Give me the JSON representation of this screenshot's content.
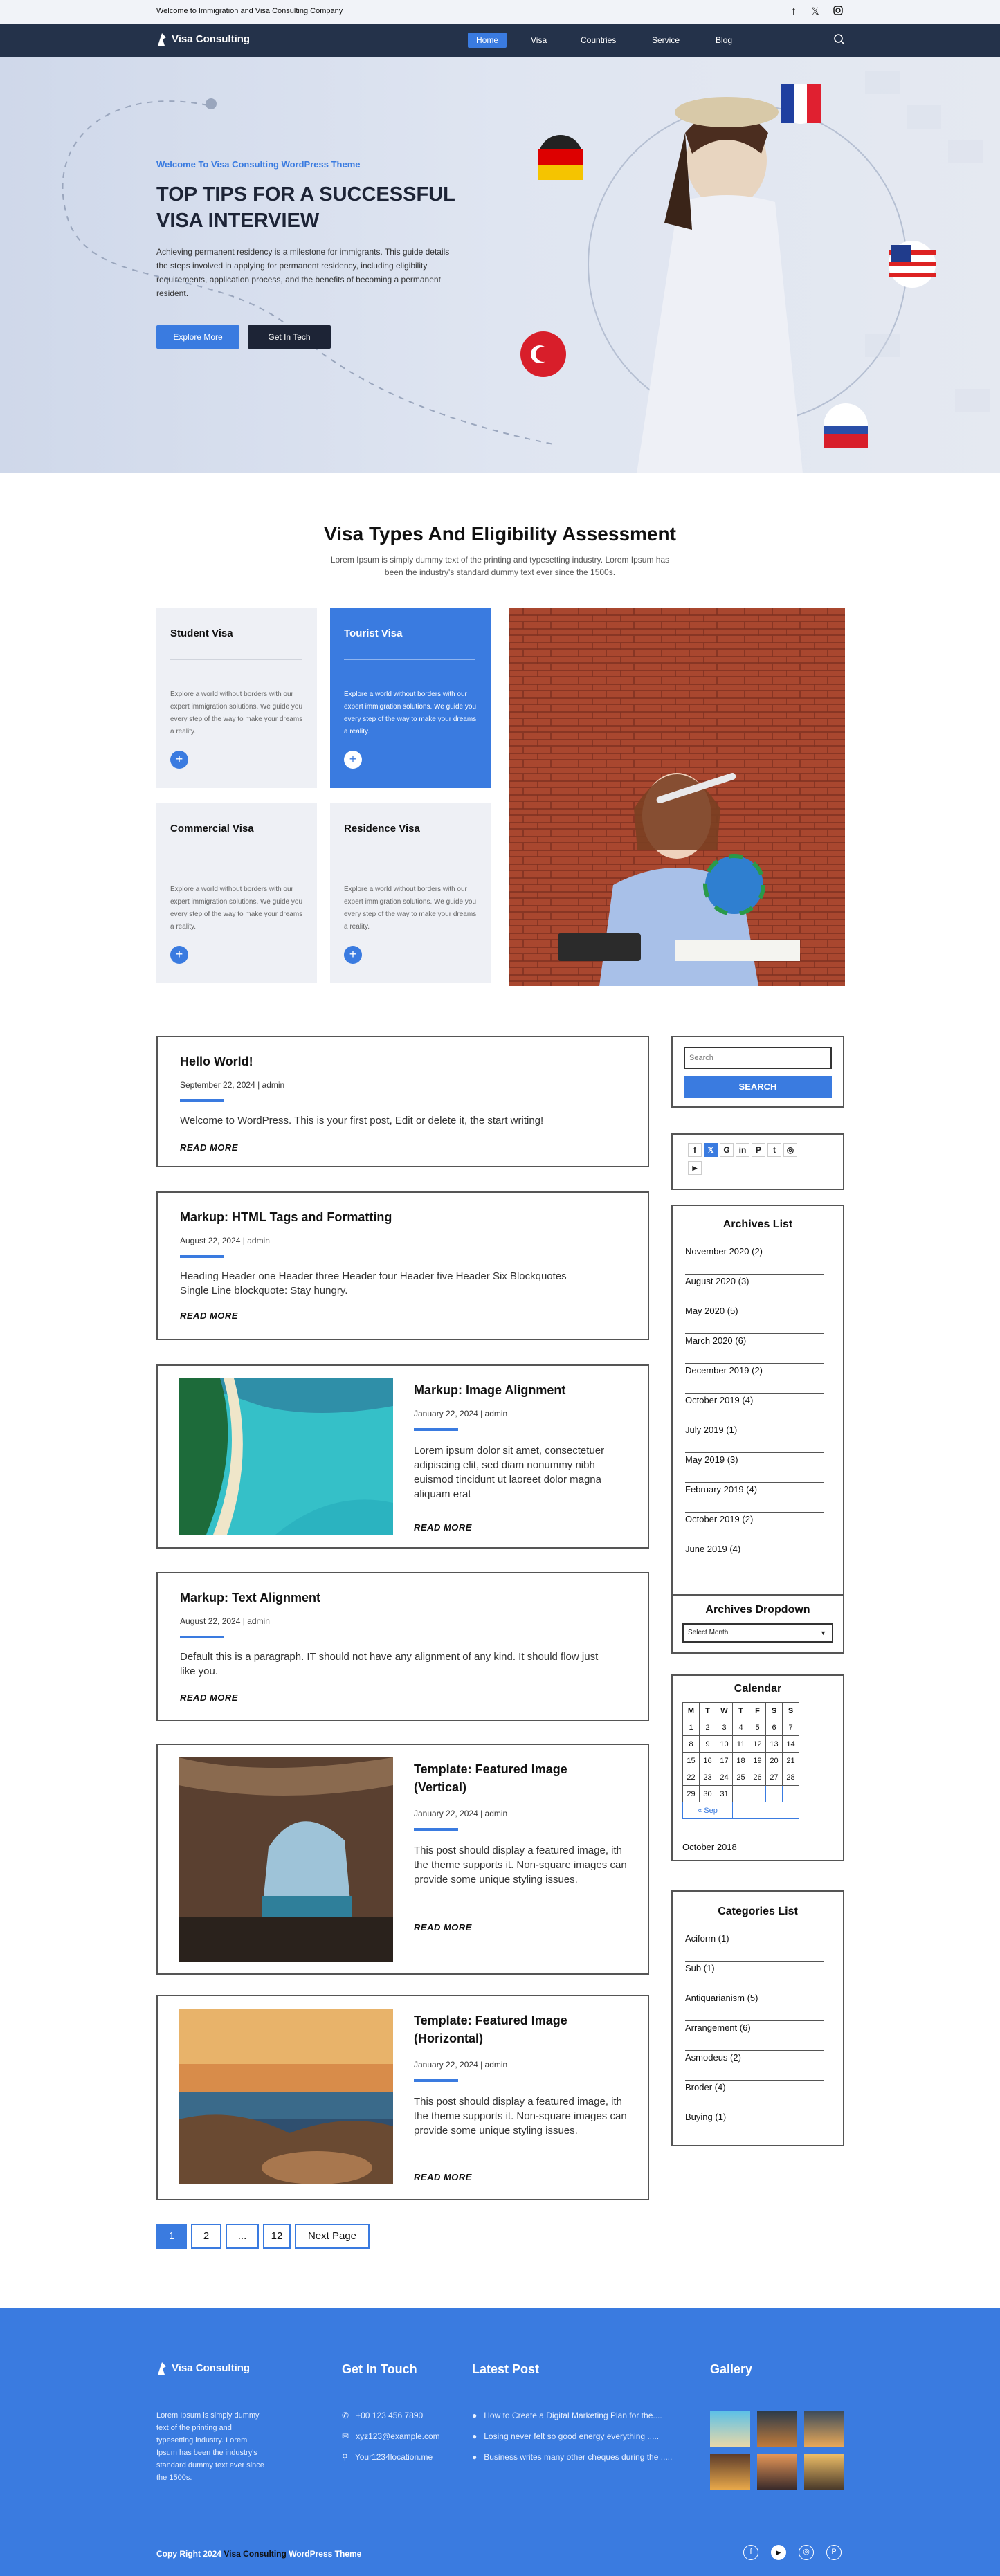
{
  "topbar": {
    "welcome": "Welcome to Immigration and Visa Consulting Company"
  },
  "brand": {
    "name": "Visa Consulting",
    "accent": "#3a7be0",
    "dark": "#24324a"
  },
  "nav": {
    "items": [
      "Home",
      "Visa",
      "Countries",
      "Service",
      "Blog"
    ],
    "active": "Home"
  },
  "hero": {
    "tagline": "Welcome To Visa Consulting WordPress Theme",
    "title": "TOP TIPS FOR A SUCCESSFUL VISA INTERVIEW",
    "desc": "Achieving permanent residency is a milestone for immigrants. This guide details the steps involved in applying for permanent residency, including eligibility requirements, application process, and the benefits of becoming a permanent resident.",
    "btn_primary": "Explore More",
    "btn_secondary": "Get In Tech"
  },
  "visa": {
    "title": "Visa Types And Eligibility Assessment",
    "subtitle": "Lorem Ipsum is simply dummy text of the printing and typesetting industry. Lorem Ipsum has been the industry's standard dummy text ever since the 1500s.",
    "cards": [
      {
        "title": "Student Visa",
        "desc": "Explore a world without borders with our expert immigration solutions. We guide you every step of the way to make your dreams a reality."
      },
      {
        "title": "Tourist Visa",
        "desc": "Explore a world without borders with our expert immigration solutions. We guide you every step of the way to make your dreams a reality."
      },
      {
        "title": "Commercial Visa",
        "desc": "Explore a world without borders with our expert immigration solutions. We guide you every step of the way to make your dreams a reality."
      },
      {
        "title": "Residence Visa",
        "desc": "Explore a world without borders with our expert immigration solutions. We guide you every step of the way to make your dreams a reality."
      }
    ]
  },
  "posts": [
    {
      "title": "Hello World!",
      "meta": "September 22, 2024 | admin",
      "excerpt": "Welcome to WordPress. This is your first post, Edit or delete it, the start writing!",
      "more": "READ MORE"
    },
    {
      "title": "Markup: HTML Tags and Formatting",
      "meta": "August 22, 2024 | admin",
      "excerpt": "Heading Header one Header three Header four Header five Header Six Blockquotes Single Line blockquote: Stay hungry.",
      "more": "READ MORE"
    },
    {
      "title": "Markup: Image Alignment",
      "meta": "January 22, 2024 | admin",
      "excerpt": "Lorem ipsum dolor sit amet, consectetuer adipiscing elit, sed diam nonummy nibh euismod tincidunt ut laoreet dolor magna aliquam erat",
      "more": "READ MORE"
    },
    {
      "title": "Markup: Text Alignment",
      "meta": "August 22, 2024 | admin",
      "excerpt": "Default this is a paragraph. IT should not have any alignment of any kind. It should flow just like you.",
      "more": "READ MORE"
    },
    {
      "title": "Template: Featured Image (Vertical)",
      "meta": "January 22, 2024 | admin",
      "excerpt": "This post should display a featured image, ith the theme supports it. Non-square images can provide some unique styling issues.",
      "more": "READ MORE"
    },
    {
      "title": "Template: Featured Image (Horizontal)",
      "meta": "January 22, 2024 | admin",
      "excerpt": "This post should display a featured image, ith the theme supports it. Non-square images can provide some unique styling issues.",
      "more": "READ MORE"
    }
  ],
  "pagination": {
    "items": [
      "1",
      "2",
      "...",
      "12"
    ],
    "next": "Next Page"
  },
  "sidebar": {
    "search": {
      "placeholder": "Search",
      "button": "SEARCH"
    },
    "archives": {
      "title": "Archives List",
      "items": [
        "November 2020 (2)",
        "August 2020 (3)",
        "May 2020 (5)",
        "March 2020 (6)",
        "December 2019 (2)",
        "October 2019 (4)",
        "July 2019 (1)",
        "May 2019 (3)",
        "February 2019 (4)",
        "October 2019 (2)",
        "June 2019 (4)"
      ]
    },
    "dropdown": {
      "title": "Archives Dropdown",
      "selected": "Select Month"
    },
    "calendar": {
      "title": "Calendar",
      "days": [
        "M",
        "T",
        "W",
        "T",
        "F",
        "S",
        "S"
      ],
      "weeks": [
        [
          "1",
          "2",
          "3",
          "4",
          "5",
          "6",
          "7"
        ],
        [
          "8",
          "9",
          "10",
          "11",
          "12",
          "13",
          "14"
        ],
        [
          "15",
          "16",
          "17",
          "18",
          "19",
          "20",
          "21"
        ],
        [
          "22",
          "23",
          "24",
          "25",
          "26",
          "27",
          "28"
        ],
        [
          "29",
          "30",
          "31",
          "",
          "",
          "",
          ""
        ]
      ],
      "prev": "« Sep",
      "month": "October 2018"
    },
    "categories": {
      "title": "Categories List",
      "items": [
        "Aciform (1)",
        "Sub (1)",
        "Antiquarianism (5)",
        "Arrangement (6)",
        "Asmodeus (2)",
        "Broder (4)",
        "Buying (1)"
      ]
    }
  },
  "footer": {
    "about": "Lorem Ipsum is simply dummy text of the printing and typesetting industry. Lorem Ipsum has been the industry's standard dummy text ever since the 1500s.",
    "contact": {
      "title": "Get In Touch",
      "phone": "+00 123 456 7890",
      "email": "xyz123@example.com",
      "location": "Your1234location.me"
    },
    "latest": {
      "title": "Latest Post",
      "items": [
        "How to Create a Digital Marketing Plan for the....",
        "Losing never felt so good energy everything .....",
        "Business writes many other cheques during the ....."
      ]
    },
    "gallery": {
      "title": "Gallery"
    },
    "copyright": {
      "prefix": "Copy Right 2024",
      "brand": "Visa Consulting",
      "suffix": "WordPress Theme"
    }
  }
}
